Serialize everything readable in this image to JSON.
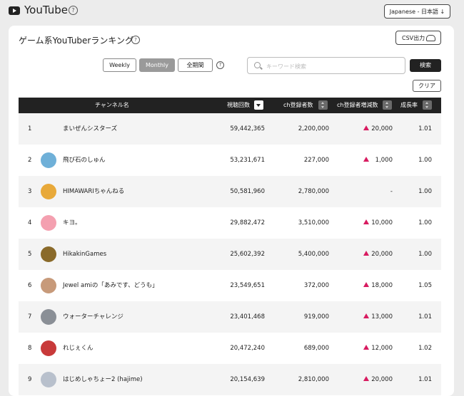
{
  "header": {
    "app_title": "YouTube",
    "help": "?",
    "language_button": "Japanese - 日本語 ↓"
  },
  "panel": {
    "title": "ゲーム系YouTuberランキング",
    "help": "?",
    "csv_button": "CSV出力"
  },
  "period_tabs": [
    {
      "label": "Weekly",
      "active": false
    },
    {
      "label": "Monthly",
      "active": true
    },
    {
      "label": "全期間",
      "active": false
    }
  ],
  "search": {
    "placeholder": "キーワード検索",
    "value": "",
    "button": "検索",
    "clear_button": "クリア"
  },
  "table": {
    "columns": {
      "channel": "チャンネル名",
      "views": "視聴回数",
      "subscribers": "ch登録者数",
      "increase": "ch登録者増減数",
      "growth": "成長率"
    },
    "sorted_by": "views",
    "rows": [
      {
        "rank": "1",
        "name": "まいぜんシスターズ",
        "views": "59,442,365",
        "subscribers": "2,200,000",
        "increase": "20,000",
        "up": true,
        "growth": "1.01",
        "avatar_color": ""
      },
      {
        "rank": "2",
        "name": "飛び石のしゅん",
        "views": "53,231,671",
        "subscribers": "227,000",
        "increase": "1,000",
        "up": true,
        "growth": "1.00",
        "avatar_color": "#6fb0d8"
      },
      {
        "rank": "3",
        "name": "HIMAWARIちゃんねる",
        "views": "50,581,960",
        "subscribers": "2,780,000",
        "increase": "-",
        "up": false,
        "growth": "1.00",
        "avatar_color": "#e8a93a"
      },
      {
        "rank": "4",
        "name": "キヨ。",
        "views": "29,882,472",
        "subscribers": "3,510,000",
        "increase": "10,000",
        "up": true,
        "growth": "1.00",
        "avatar_color": "#f4a0b0"
      },
      {
        "rank": "5",
        "name": "HikakinGames",
        "views": "25,602,392",
        "subscribers": "5,400,000",
        "increase": "20,000",
        "up": true,
        "growth": "1.00",
        "avatar_color": "#8a6a2a"
      },
      {
        "rank": "6",
        "name": "Jewel amiの「あみです、どうも」",
        "views": "23,549,651",
        "subscribers": "372,000",
        "increase": "18,000",
        "up": true,
        "growth": "1.05",
        "avatar_color": "#c79a7a"
      },
      {
        "rank": "7",
        "name": "ウォーターチャレンジ",
        "views": "23,401,468",
        "subscribers": "919,000",
        "increase": "13,000",
        "up": true,
        "growth": "1.01",
        "avatar_color": "#8a8f96"
      },
      {
        "rank": "8",
        "name": "れじぇくん",
        "views": "20,472,240",
        "subscribers": "689,000",
        "increase": "12,000",
        "up": true,
        "growth": "1.02",
        "avatar_color": "#c83a3a"
      },
      {
        "rank": "9",
        "name": "はじめしゃちょー2 (hajime)",
        "views": "20,154,639",
        "subscribers": "2,810,000",
        "increase": "20,000",
        "up": true,
        "growth": "1.01",
        "avatar_color": "#b8c0cc"
      }
    ]
  }
}
